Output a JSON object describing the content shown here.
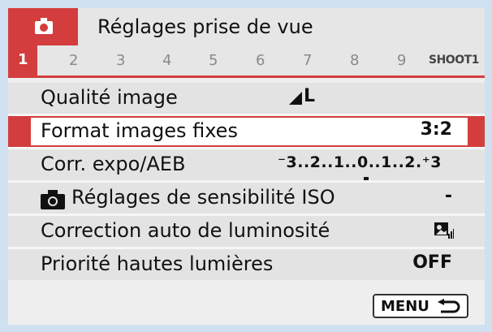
{
  "header": {
    "title": "Réglages prise de vue",
    "icon": "camera-icon"
  },
  "tabs": {
    "active": "1",
    "numbers": [
      "2",
      "3",
      "4",
      "5",
      "6",
      "7",
      "8",
      "9"
    ],
    "label": "SHOOT1"
  },
  "menu": {
    "items": [
      {
        "label": "Qualité image",
        "value": "L"
      },
      {
        "label": "Format images fixes",
        "value": "3:2"
      },
      {
        "label": "Corr. expo/AEB",
        "value": "⁻3..2..1..0..1..2.⁺3"
      },
      {
        "label": "Réglages de sensibilité ISO",
        "value": "-"
      },
      {
        "label": "Correction auto de luminosité",
        "value": ""
      },
      {
        "label": "Priorité hautes lumières",
        "value": "OFF"
      }
    ],
    "selected_index": 1
  },
  "footer": {
    "menu_label": "MENU"
  },
  "colors": {
    "accent": "#d33d3d",
    "background": "#eeeeee"
  }
}
